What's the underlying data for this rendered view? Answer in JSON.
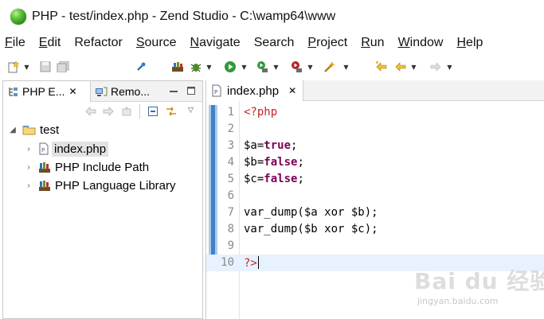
{
  "window": {
    "title": "PHP - test/index.php - Zend Studio - C:\\wamp64\\www"
  },
  "menu": [
    {
      "label": "File",
      "mnemonic": "F",
      "rest": "ile"
    },
    {
      "label": "Edit",
      "mnemonic": "E",
      "rest": "dit"
    },
    {
      "label": "Refactor",
      "mnemonic": "",
      "rest": "Refactor"
    },
    {
      "label": "Source",
      "mnemonic": "S",
      "rest": "ource"
    },
    {
      "label": "Navigate",
      "mnemonic": "N",
      "rest": "avigate"
    },
    {
      "label": "Search",
      "mnemonic": "",
      "rest": "Search"
    },
    {
      "label": "Project",
      "mnemonic": "P",
      "rest": "roject"
    },
    {
      "label": "Run",
      "mnemonic": "R",
      "rest": "un"
    },
    {
      "label": "Window",
      "mnemonic": "W",
      "rest": "indow"
    },
    {
      "label": "Help",
      "mnemonic": "H",
      "rest": "elp"
    }
  ],
  "left_panel": {
    "tabs": [
      {
        "label": "PHP E..."
      },
      {
        "label": "Remo..."
      }
    ],
    "tree": {
      "project": "test",
      "children": [
        {
          "label": "index.php"
        },
        {
          "label": "PHP Include Path"
        },
        {
          "label": "PHP Language Library"
        }
      ]
    }
  },
  "editor": {
    "tab_label": "index.php",
    "lines": [
      {
        "number": "1",
        "parts": [
          {
            "t": "<?php",
            "c": "tag"
          }
        ]
      },
      {
        "number": "2",
        "parts": []
      },
      {
        "number": "3",
        "parts": [
          {
            "t": "$a=",
            "c": "var"
          },
          {
            "t": "true",
            "c": "kw"
          },
          {
            "t": ";",
            "c": "var"
          }
        ]
      },
      {
        "number": "4",
        "parts": [
          {
            "t": "$b=",
            "c": "var"
          },
          {
            "t": "false",
            "c": "kw"
          },
          {
            "t": ";",
            "c": "var"
          }
        ]
      },
      {
        "number": "5",
        "parts": [
          {
            "t": "$c=",
            "c": "var"
          },
          {
            "t": "false",
            "c": "kw"
          },
          {
            "t": ";",
            "c": "var"
          }
        ]
      },
      {
        "number": "6",
        "parts": []
      },
      {
        "number": "7",
        "parts": [
          {
            "t": "var_dump($a xor $b);",
            "c": "var"
          }
        ]
      },
      {
        "number": "8",
        "parts": [
          {
            "t": "var_dump($b xor $c);",
            "c": "var"
          }
        ]
      },
      {
        "number": "9",
        "parts": []
      },
      {
        "number": "10",
        "parts": [
          {
            "t": "?>",
            "c": "tag"
          }
        ]
      }
    ],
    "current_line": 10
  },
  "watermark": {
    "main": "Bai du 经验",
    "sub": "jingyan.baidu.com"
  },
  "colors": {
    "keyword": "#7f0055",
    "php_tag": "#c6222a",
    "current_line_bg": "#e8f2fe",
    "marker_bar": "#3e82c9"
  }
}
